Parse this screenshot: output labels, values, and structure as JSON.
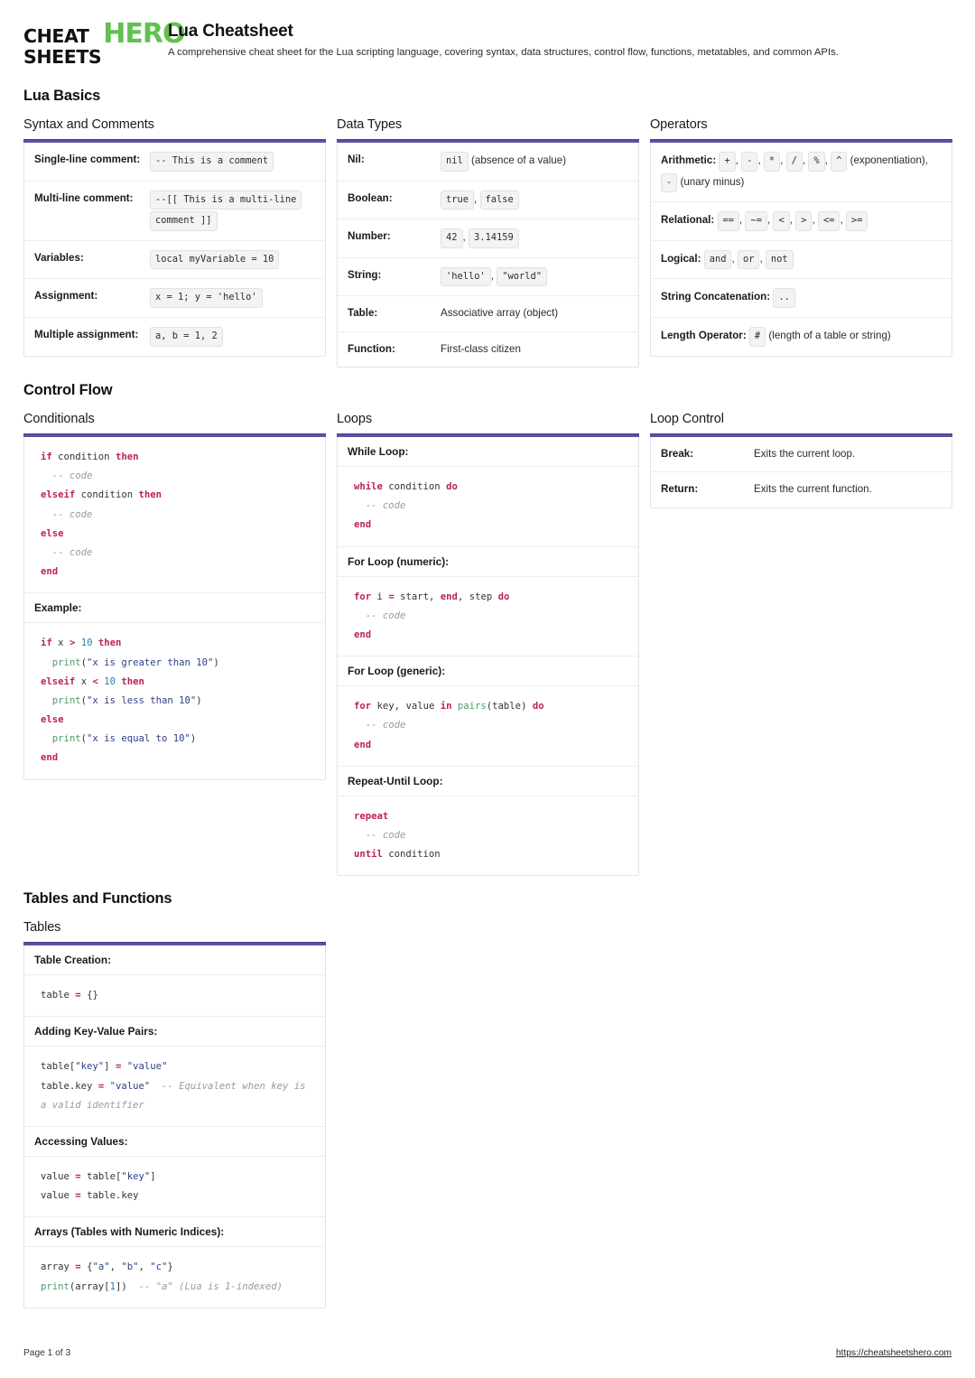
{
  "header": {
    "logo": {
      "line1_dark": "CHEAT",
      "line2_dark": "SHEETS",
      "accent": "HERO",
      "accent_color": "#5fc24e"
    },
    "title": "Lua Cheatsheet",
    "subtitle": "A comprehensive cheat sheet for the Lua scripting language, covering syntax, data structures, control flow, functions, metatables, and common APIs."
  },
  "theme": {
    "accent_bar": "#5b50a5",
    "keyword": "#bb2158",
    "number": "#2a7ab0",
    "string": "#2d3f83",
    "function": "#4e9a6a",
    "comment": "#9a9a9a"
  },
  "sections": {
    "lua_basics": "Lua Basics",
    "control_flow": "Control Flow",
    "tables_and_functions": "Tables and Functions"
  },
  "cards": {
    "syntax_and_comments": {
      "title": "Syntax and Comments",
      "rows": [
        {
          "label": "Single-line comment:",
          "chips": [
            "-- This is a comment"
          ]
        },
        {
          "label": "Multi-line comment:",
          "chips": [
            "--[[ This is a multi-line",
            "comment ]]"
          ]
        },
        {
          "label": "Variables:",
          "chips": [
            "local myVariable = 10"
          ]
        },
        {
          "label": "Assignment:",
          "chips": [
            "x = 1; y = 'hello'"
          ]
        },
        {
          "label": "Multiple assignment:",
          "chips": [
            "a, b = 1, 2"
          ]
        }
      ]
    },
    "data_types": {
      "title": "Data Types",
      "rows": [
        {
          "label": "Nil:",
          "chips": [
            "nil"
          ],
          "text": "(absence of a value)"
        },
        {
          "label": "Boolean:",
          "chips": [
            "true",
            "false"
          ],
          "text": ""
        },
        {
          "label": "Number:",
          "chips": [
            "42",
            "3.14159"
          ],
          "text": ""
        },
        {
          "label": "String:",
          "chips": [
            "'hello'",
            "\"world\""
          ],
          "text": ""
        },
        {
          "label": "Table:",
          "chips": [],
          "text": "Associative array (object)"
        },
        {
          "label": "Function:",
          "chips": [],
          "text": "First-class citizen"
        }
      ]
    },
    "operators": {
      "title": "Operators",
      "rows": [
        {
          "label": "Arithmetic:",
          "chips": [
            "+",
            "-",
            "*",
            "/",
            "%",
            "^"
          ],
          "text": "(exponentiation),",
          "chips2": [
            "-"
          ],
          "text2": "(unary minus)"
        },
        {
          "label": "Relational:",
          "chips": [
            "==",
            "~=",
            "<",
            ">",
            "<=",
            ">="
          ],
          "text": ""
        },
        {
          "label": "Logical:",
          "chips": [
            "and",
            "or",
            "not"
          ],
          "text": ""
        },
        {
          "label": "String Concatenation:",
          "chips": [
            ".."
          ],
          "text": ""
        },
        {
          "label": "Length Operator:",
          "chips": [
            "#"
          ],
          "text": "(length of a table or string)"
        }
      ]
    },
    "conditionals": {
      "title": "Conditionals",
      "code1_label": "",
      "example_label": "Example:"
    },
    "loops": {
      "title": "Loops",
      "while_label": "While Loop:",
      "for_numeric_label": "For Loop (numeric):",
      "for_generic_label": "For Loop (generic):",
      "repeat_label": "Repeat-Until Loop:"
    },
    "loop_control": {
      "title": "Loop Control",
      "rows": [
        {
          "label": "Break:",
          "text": "Exits the current loop."
        },
        {
          "label": "Return:",
          "text": "Exits the current function."
        }
      ]
    },
    "tables": {
      "title": "Tables",
      "creation_label": "Table Creation:",
      "adding_label": "Adding Key-Value Pairs:",
      "accessing_label": "Accessing Values:",
      "arrays_label": "Arrays (Tables with Numeric Indices):"
    }
  },
  "code": {
    "conditionals_syntax": "if condition then\n  -- code\nelseif condition then\n  -- code\nelse\n  -- code\nend",
    "conditionals_example": "if x > 10 then\n  print(\"x is greater than 10\")\nelseif x < 10 then\n  print(\"x is less than 10\")\nelse\n  print(\"x is equal to 10\")\nend",
    "while_loop": "while condition do\n  -- code\nend",
    "for_numeric": "for i = start, end, step do\n  -- code\nend",
    "for_generic": "for key, value in pairs(table) do\n  -- code\nend",
    "repeat_until": "repeat\n  -- code\nuntil condition",
    "table_creation": "table = {}",
    "table_adding": "table[\"key\"] = \"value\"\ntable.key = \"value\"  -- Equivalent when key is a valid identifier",
    "table_accessing": "value = table[\"key\"]\nvalue = table.key",
    "table_arrays": "array = {\"a\", \"b\", \"c\"}\nprint(array[1])  -- \"a\" (Lua is 1-indexed)"
  },
  "footer": {
    "page": "Page 1 of 3",
    "url": "https://cheatsheetshero.com"
  }
}
